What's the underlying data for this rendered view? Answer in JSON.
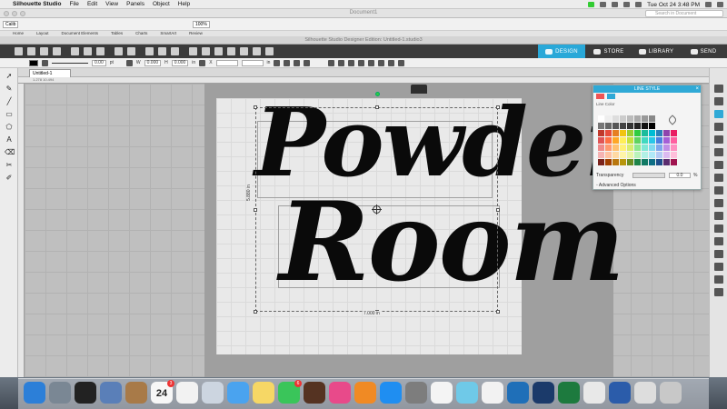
{
  "menubar": {
    "app": "Silhouette Studio",
    "items": [
      "File",
      "Edit",
      "View",
      "Panels",
      "Object",
      "Help"
    ],
    "clock": "Tue Oct 24  3:48 PM"
  },
  "docwindow": {
    "title": "Document1",
    "search_placeholder": "Search in Document",
    "ribbon_tabs": [
      "Home",
      "Layout",
      "Document Elements",
      "Tables",
      "Charts",
      "SmartArt",
      "Review"
    ],
    "font_box": "Calib",
    "zoom": "100%"
  },
  "silhouette": {
    "title": "Silhouette Studio Designer Edition: Untitled-1.studio3",
    "nav": [
      "DESIGN",
      "STORE",
      "LIBRARY",
      "SEND"
    ],
    "doc_tab": "Untitled-1",
    "line_width": "0.00",
    "w_label": "W",
    "w_value": "0.000",
    "h_label": "H",
    "h_value": "0.000",
    "x_label": "X",
    "unit": "in",
    "unit_pt": "pt"
  },
  "canvas": {
    "line1": "Powder",
    "line2": "Room",
    "width_label": "7.000 in",
    "height_label": "5.880 in",
    "ruler_label": "1.278  10.494"
  },
  "panel": {
    "title": "LINE STYLE",
    "subtitle": "Line Color",
    "transparency_label": "Transparency",
    "transparency_value": "0.0",
    "percent": "%",
    "advanced": "Advanced Options",
    "palette": [
      "#ffffff",
      "#eeeeee",
      "#dddddd",
      "#cccccc",
      "#bbbbbb",
      "#aaaaaa",
      "#999999",
      "#888888",
      "#f4f4f4",
      "#f4f4f4",
      "#f4f4f4",
      "#777777",
      "#666666",
      "#555555",
      "#444444",
      "#333333",
      "#222222",
      "#111111",
      "#000000",
      "#f4f4f4",
      "#f4f4f4",
      "#f4f4f4",
      "#c0392b",
      "#e74c3c",
      "#e67e22",
      "#f1c40f",
      "#9acd32",
      "#2ecc40",
      "#1abc9c",
      "#00bcd4",
      "#2980b9",
      "#8e44ad",
      "#e91e63",
      "#e05555",
      "#ff7043",
      "#ffa726",
      "#ffee58",
      "#c6e03b",
      "#5fd35f",
      "#3fd9c0",
      "#29c7e8",
      "#4a7fe0",
      "#a55fd6",
      "#ff5fa0",
      "#ef8a8a",
      "#ff9a70",
      "#ffc170",
      "#fff176",
      "#d9ec6e",
      "#8ee88e",
      "#7fe8d6",
      "#7fdaf0",
      "#7ea6ec",
      "#c08ee6",
      "#ff8fc0",
      "#f6b3b3",
      "#ffc2a3",
      "#ffd9a3",
      "#fff5a8",
      "#e9f5a6",
      "#baf2ba",
      "#b2f1e6",
      "#b0e9f7",
      "#b4cbf4",
      "#dcbaf1",
      "#ffbfdb",
      "#7b241c",
      "#a04000",
      "#b9770e",
      "#b7950b",
      "#6b8e23",
      "#1e8449",
      "#117a65",
      "#0e6e85",
      "#1f4e8c",
      "#5b2c6f",
      "#a0144f"
    ]
  },
  "dock": {
    "calendar_day": "24",
    "calendar_month": "OCT",
    "badges": {
      "calendar": "3",
      "messages": "6"
    },
    "icons": [
      "finder-icon",
      "launchpad-icon",
      "photo-booth-icon",
      "preview-icon",
      "contacts-icon",
      "calendar-icon",
      "reminders-icon",
      "photos-viewer-icon",
      "messages-icon",
      "notes-icon",
      "facetime-icon",
      "photo-app-icon",
      "itunes-icon",
      "ibooks-icon",
      "app-store-icon",
      "system-preferences-icon",
      "chrome-icon",
      "silhouette-icon",
      "photos-icon",
      "quicktime-icon",
      "affinity-icon",
      "excel-icon",
      "screenshot-icon",
      "word-icon",
      "iphone-icon",
      "trash-icon"
    ],
    "colors": [
      "#2c7fd8",
      "#7a8794",
      "#222222",
      "#5a7fb8",
      "#a87a48",
      "#f7f7f7",
      "#f2f2f2",
      "#ccd5e0",
      "#4aa3ef",
      "#f6d765",
      "#3ac55a",
      "#553322",
      "#e84a8a",
      "#f08a24",
      "#1f8ef1",
      "#7d7d7d",
      "#f4f4f4",
      "#6fc9e8",
      "#f2f2f2",
      "#1f6fb8",
      "#1b3a6a",
      "#1d7a3e",
      "#e8e8e8",
      "#2b5caa",
      "#dddddd",
      "#c8c8c8"
    ]
  }
}
